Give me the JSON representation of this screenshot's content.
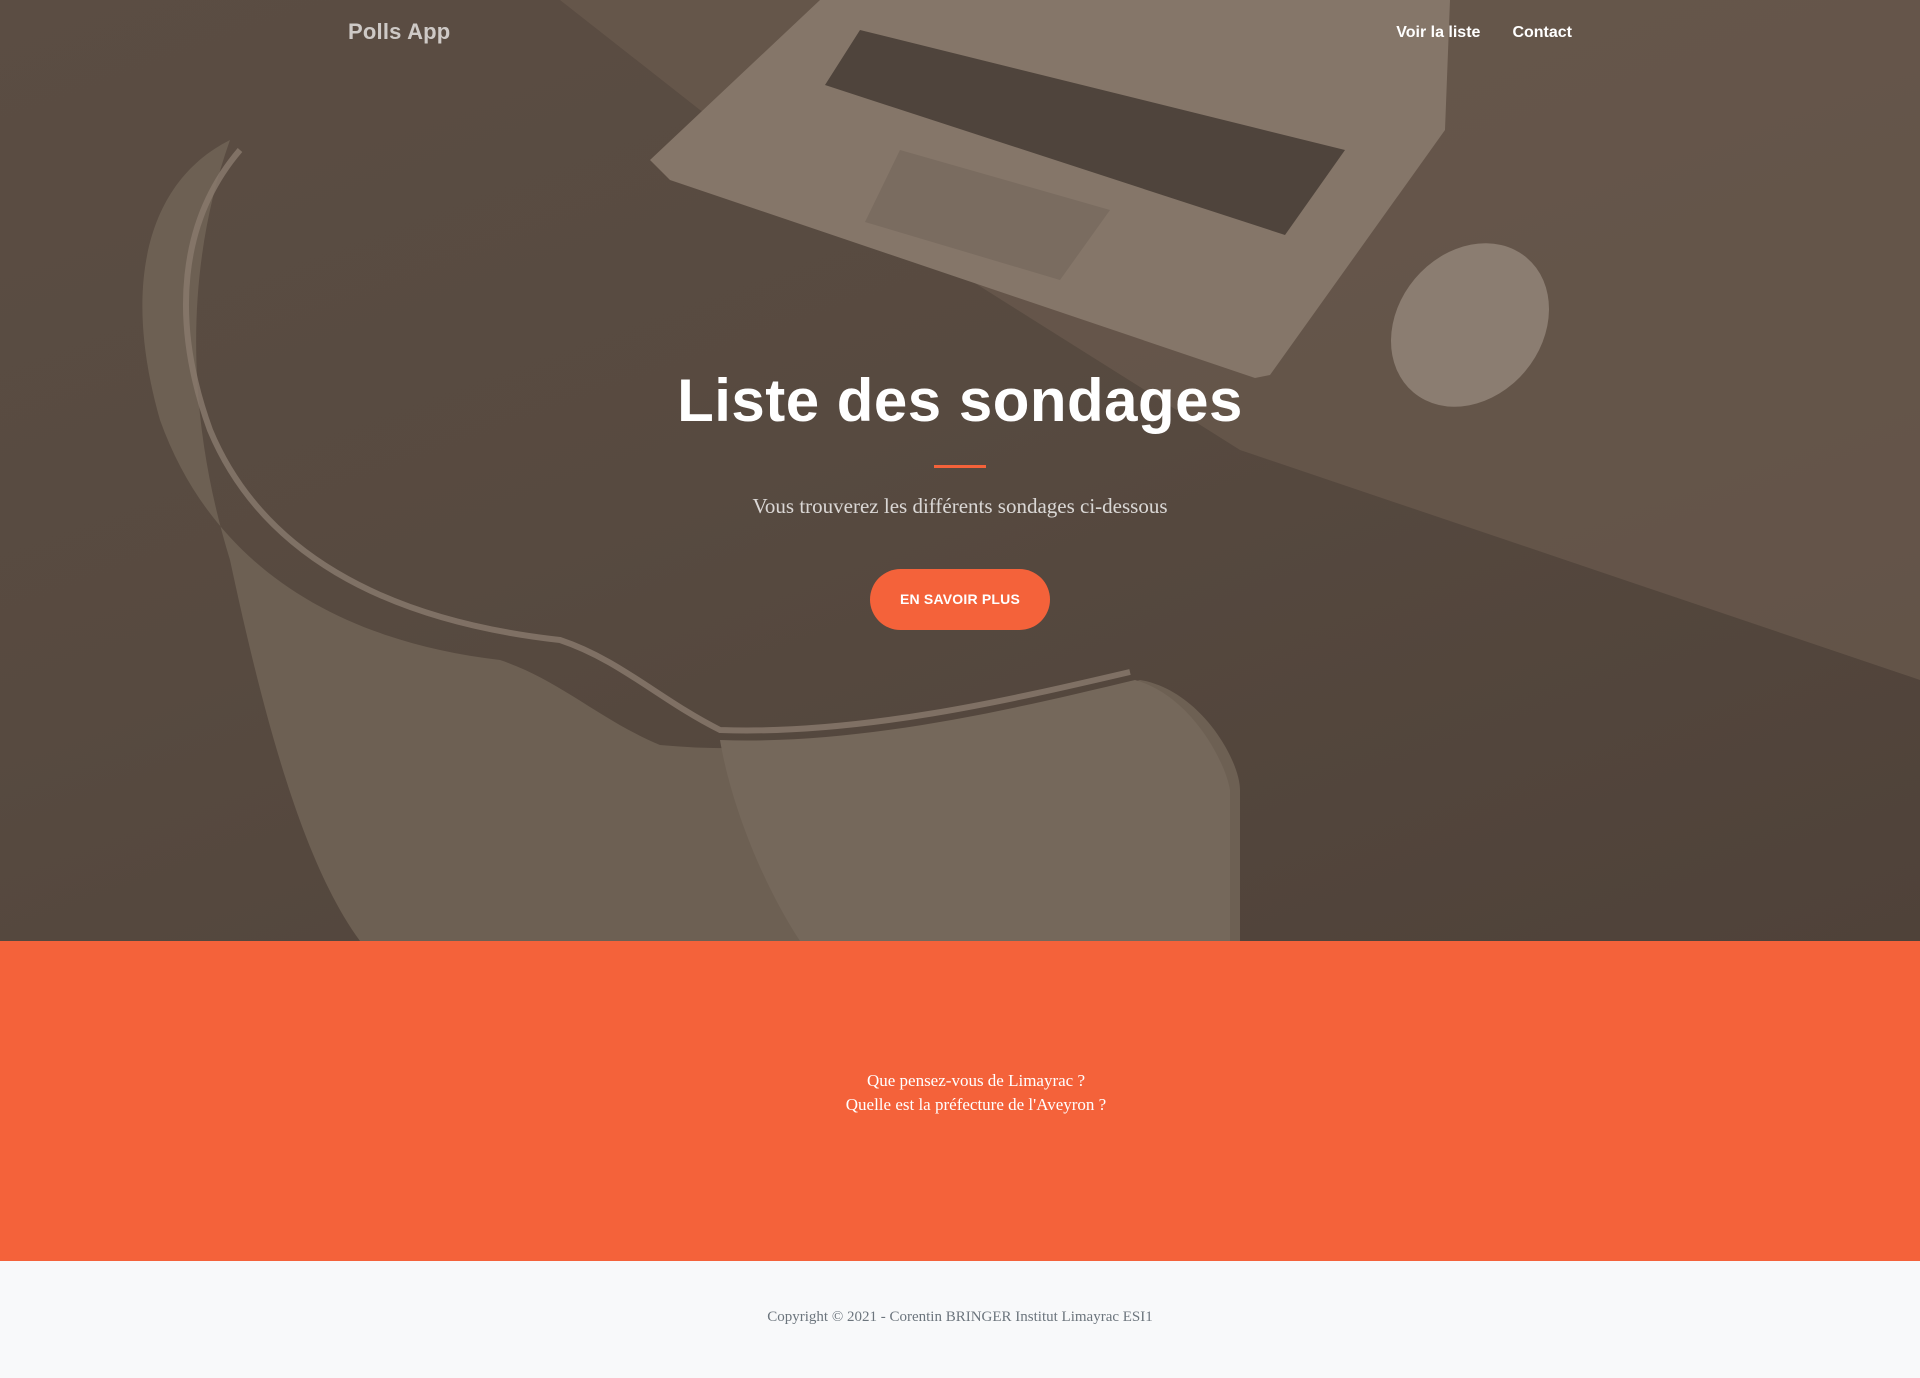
{
  "navbar": {
    "brand": "Polls App",
    "links": [
      {
        "label": "Voir la liste"
      },
      {
        "label": "Contact"
      }
    ]
  },
  "hero": {
    "title": "Liste des sondages",
    "subtitle": "Vous trouverez les différents sondages ci-dessous",
    "cta_label": "En savoir plus"
  },
  "polls": {
    "items": [
      {
        "question": "Que pensez-vous de Limayrac ?"
      },
      {
        "question": "Quelle est la préfecture de l'Aveyron ?"
      }
    ]
  },
  "footer": {
    "copyright": "Copyright © 2021 - Corentin BRINGER Institut Limayrac ESI1"
  },
  "theme": {
    "accent": "#f4623a",
    "hero_overlay": "#574a40",
    "footer_bg": "#f8f9fa"
  }
}
